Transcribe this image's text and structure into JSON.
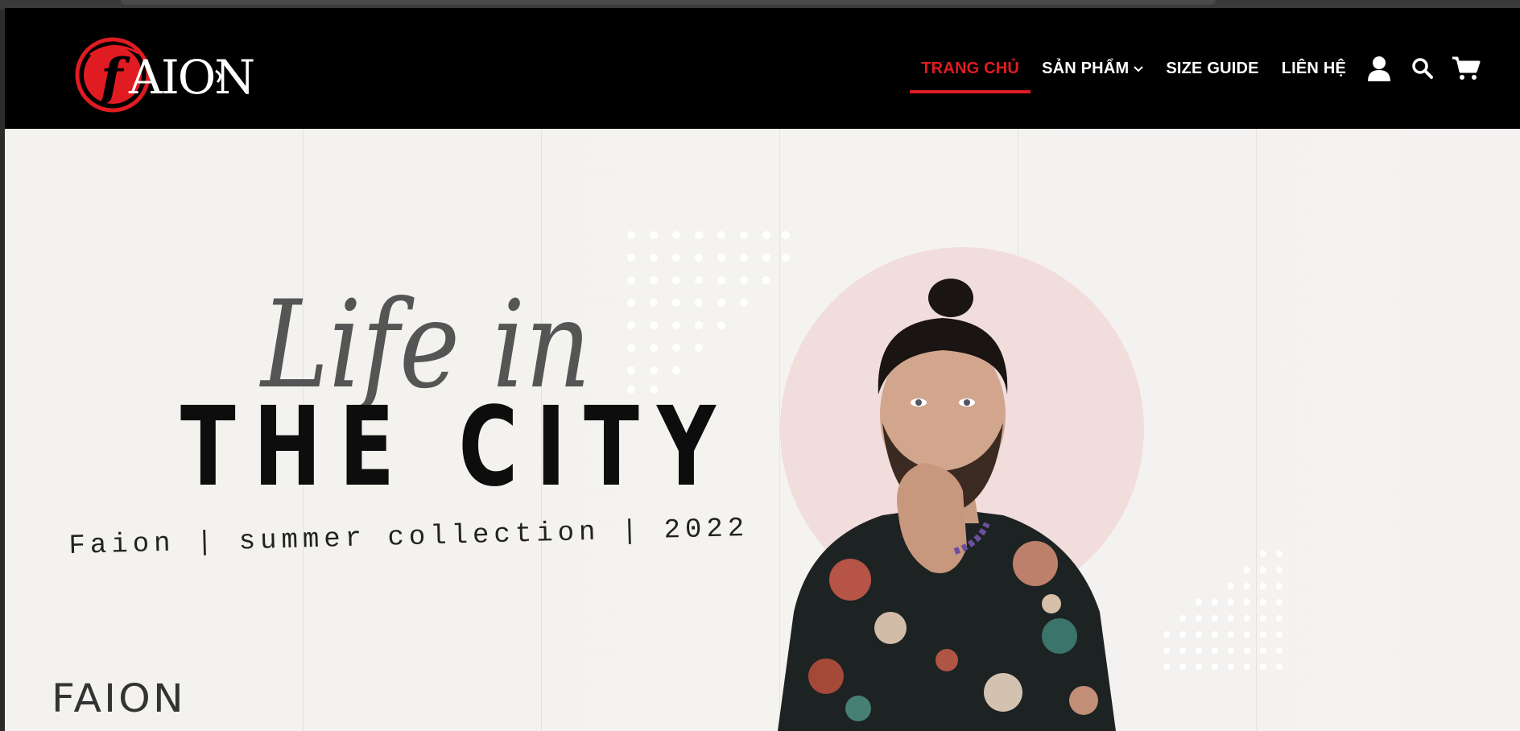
{
  "brand": {
    "logo_text": "FAION",
    "logo_letter": "F",
    "accent": "#e11b22"
  },
  "nav": {
    "items": [
      {
        "label": "TRANG CHỦ",
        "active": true
      },
      {
        "label": "SẢN PHẨM",
        "dropdown": true
      },
      {
        "label": "SIZE GUIDE"
      },
      {
        "label": "LIÊN HỆ"
      }
    ],
    "icons": [
      "user-icon",
      "search-icon",
      "cart-icon"
    ]
  },
  "hero": {
    "script_title": "Life in",
    "headline": "THE CITY",
    "tagline": "Faion | summer collection | 2022",
    "footer_brand": "FAION",
    "colors": {
      "circle": "#f1dddc",
      "background": "#f4f3ef"
    }
  }
}
